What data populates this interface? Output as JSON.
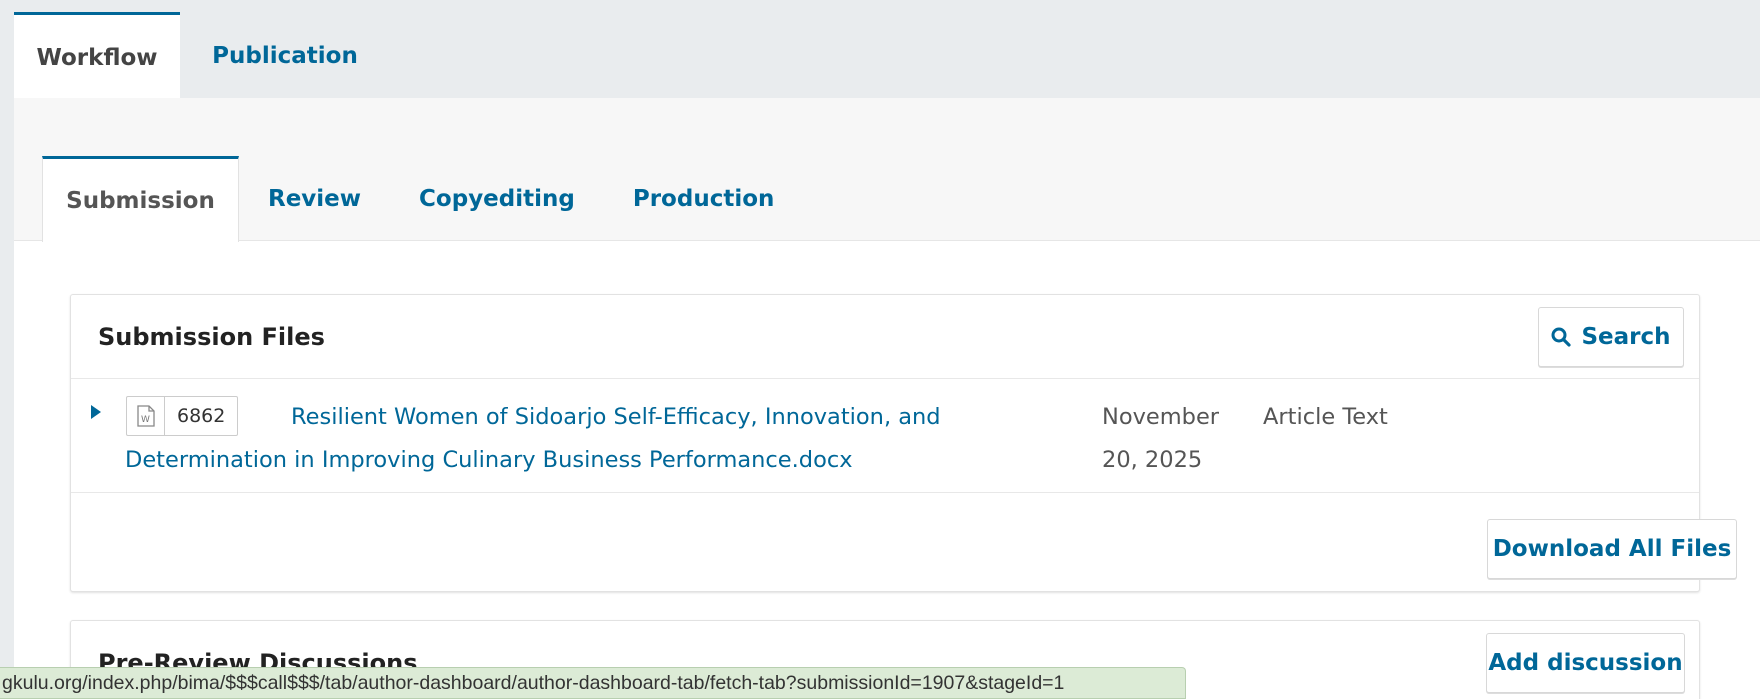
{
  "top_tabs": [
    {
      "label": "Workflow",
      "active": true
    },
    {
      "label": "Publication",
      "active": false
    }
  ],
  "stage_tabs": [
    {
      "label": "Submission",
      "active": true
    },
    {
      "label": "Review",
      "active": false
    },
    {
      "label": "Copyediting",
      "active": false
    },
    {
      "label": "Production",
      "active": false
    }
  ],
  "submission_files": {
    "title": "Submission Files",
    "search_label": "Search",
    "search_icon": "magnifier-icon",
    "files": [
      {
        "type_icon": "word-document-icon",
        "id": "6862",
        "name": "Resilient Women of Sidoarjo Self-Efficacy, Innovation, and Determination in Improving Culinary Business Performance.docx",
        "date": "November 20, 2025",
        "file_type": "Article Text"
      }
    ],
    "download_all_label": "Download All Files"
  },
  "pre_review_discussions": {
    "title": "Pre-Review Discussions",
    "add_label": "Add discussion"
  },
  "status_bar": {
    "url": "gkulu.org/index.php/bima/$$$call$$$/tab/author-dashboard/author-dashboard-tab/fetch-tab?submissionId=1907&stageId=1"
  },
  "colors": {
    "accent": "#006798",
    "background": "#e9ecee",
    "status_bar_bg": "#dcebd6"
  }
}
